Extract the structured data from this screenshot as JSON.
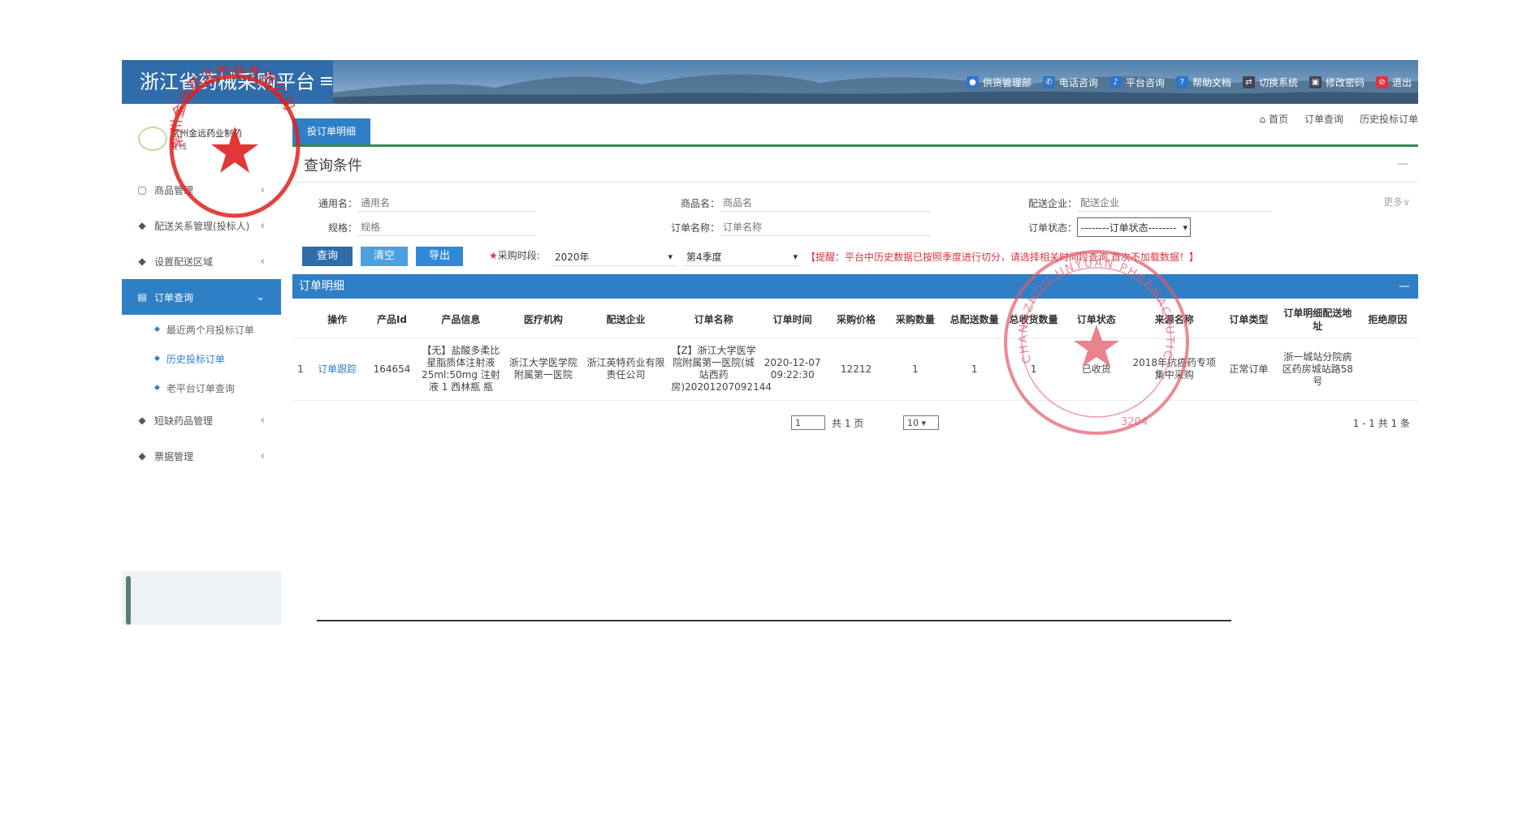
{
  "header": {
    "brand": "浙江省药械采购平台",
    "menu_toggle": "≡",
    "nav": [
      {
        "label": "供货管理部",
        "icon": "user-icon"
      },
      {
        "label": "电话咨询",
        "icon": "phone-icon"
      },
      {
        "label": "平台咨询",
        "icon": "bell-icon"
      },
      {
        "label": "帮助文档",
        "icon": "help-icon"
      },
      {
        "label": "切换系统",
        "icon": "switch-icon"
      },
      {
        "label": "修改密码",
        "icon": "lock-icon"
      },
      {
        "label": "退出",
        "icon": "exit-icon"
      }
    ]
  },
  "sidebar": {
    "user_name": "常州金远药业制药",
    "user_sub": "在线",
    "items": [
      {
        "label": "商品管理",
        "icon": "bag-icon"
      },
      {
        "label": "配送关系管理(投标人)",
        "icon": "diamond-icon"
      },
      {
        "label": "设置配送区域",
        "icon": "diamond-icon"
      },
      {
        "label": "订单查询",
        "icon": "order-icon"
      },
      {
        "label": "短缺药品管理",
        "icon": "diamond-icon"
      },
      {
        "label": "票据管理",
        "icon": "diamond-icon"
      }
    ],
    "subitems": [
      "最近两个月投标订单",
      "历史投标订单",
      "老平台订单查询"
    ]
  },
  "breadcrumb": [
    "首页",
    "订单查询",
    "历史投标订单"
  ],
  "tab": "投订单明细",
  "section_title": "查询条件",
  "form": {
    "generic_name": {
      "label": "通用名：",
      "placeholder": "通用名"
    },
    "product_name": {
      "label": "商品名：",
      "placeholder": "商品名"
    },
    "distributor": {
      "label": "配送企业：",
      "placeholder": "配送企业"
    },
    "spec": {
      "label": "规格：",
      "placeholder": "规格"
    },
    "order_name": {
      "label": "订单名称：",
      "placeholder": "订单名称"
    },
    "order_status": {
      "label": "订单状态：",
      "value": "--------订单状态--------"
    },
    "more": "更多∨"
  },
  "actions": {
    "query": "查询",
    "clear": "清空",
    "export": "导出",
    "period_label": "采购时段:",
    "year": "2020年",
    "quarter": "第4季度",
    "reminder": "【提醒：平台中历史数据已按照季度进行切分，请选择相关时间段查询,首次不加载数据！】"
  },
  "panel_title": "订单明细",
  "panel_minimize": "—",
  "table": {
    "columns": [
      "",
      "操作",
      "产品Id",
      "产品信息",
      "医疗机构",
      "配送企业",
      "订单名称",
      "订单时间",
      "采购价格",
      "采购数量",
      "总配送数量",
      "总收货数量",
      "订单状态",
      "来源名称",
      "订单类型",
      "订单明细配送地址",
      "拒绝原因"
    ],
    "rows": [
      [
        "1",
        "订单跟踪",
        "164654",
        "【无】盐酸多柔比星脂质体注射液 25ml:50mg 注射液 1 西林瓶 瓶",
        "浙江大学医学院附属第一医院",
        "浙江英特药业有限责任公司",
        "【Z】浙江大学医学院附属第一医院(城站西药房)20201207092144",
        "2020-12-07 09:22:30",
        "12212",
        "1",
        "1",
        "1",
        "已收货",
        "2018年抗癌药专项集中采购",
        "正常订单",
        "浙一城站分院病区药房城站路58号",
        ""
      ]
    ]
  },
  "pager": {
    "page": "1",
    "total_pages": "共 1 页",
    "page_size": "10",
    "summary": "1 - 1  共 1 条"
  },
  "stamps": {
    "left_text": "常州金远药业制造有限公司",
    "right_text_en": "CHANGZHOU JINYUAN PHARMACEUTICALS CO., LTD",
    "right_code": "3204"
  },
  "colors": {
    "header_blue": "#2f6ca9",
    "accent_blue": "#2f7fc6",
    "tab_underline": "#2e8b57",
    "warning_red": "#d9363e",
    "stamp_red": "#e02020"
  }
}
